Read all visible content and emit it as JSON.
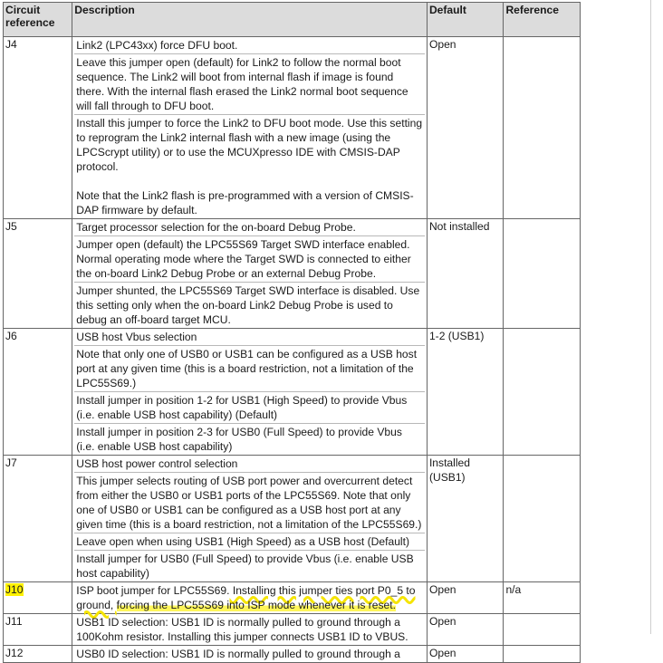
{
  "table": {
    "headers": {
      "circuit_reference": "Circuit reference",
      "description": "Description",
      "default": "Default",
      "reference": "Reference"
    },
    "rows": [
      {
        "ref": "J4",
        "desc": [
          "Link2 (LPC43xx) force DFU boot.",
          "Leave this jumper open (default) for Link2 to follow the normal boot sequence. The Link2 will boot from internal flash if image is found there. With the internal flash erased the Link2 normal boot sequence will fall through to DFU boot.",
          "Install this jumper to force the Link2 to DFU boot mode. Use this setting to reprogram the Link2 internal flash with a new image (using the LPCScrypt utility) or to use the MCUXpresso IDE with CMSIS-DAP protocol.",
          "Note that the Link2 flash is pre-programmed with a version of CMSIS-DAP firmware by default."
        ],
        "default": "Open",
        "reference": ""
      },
      {
        "ref": "J5",
        "desc": [
          "Target processor selection for the on-board Debug Probe.",
          "Jumper open (default) the LPC55S69 Target SWD interface enabled. Normal operating mode where the Target SWD is connected to either the on-board Link2 Debug Probe or an external Debug Probe.",
          "Jumper shunted, the LPC55S69 Target SWD interface is disabled. Use this setting only when the on-board Link2 Debug Probe is used to debug an off-board target MCU."
        ],
        "default": "Not installed",
        "reference": ""
      },
      {
        "ref": "J6",
        "desc": [
          "USB host Vbus selection",
          "Note that only one of USB0 or USB1 can be configured as a USB host port at any given time (this is a board restriction, not a limitation of the LPC55S69.)",
          "Install jumper in position 1-2 for USB1 (High Speed) to provide Vbus (i.e. enable USB host capability) (Default)",
          "Install jumper in position 2-3 for USB0 (Full Speed) to provide Vbus (i.e. enable USB host capability)"
        ],
        "default": "1-2 (USB1)",
        "reference": ""
      },
      {
        "ref": "J7",
        "desc": [
          "USB host power control selection",
          "This jumper selects routing of USB port power and overcurrent detect from either the USB0 or USB1 ports of the LPC55S69. Note that only one of USB0 or USB1 can be configured as a USB host port at any given time (this is a board restriction, not a limitation of the LPC55S69.)",
          "Leave open when using USB1 (High Speed) as a USB host (Default)",
          "Install jumper for USB0 (Full Speed) to provide Vbus (i.e. enable USB host capability)"
        ],
        "default": "Installed (USB1)",
        "reference": ""
      },
      {
        "ref": "J10",
        "desc_a": "ISP boot jumper for LPC55S69.",
        "desc_b": " Installing this jumper ties port P0_5 to ground, ",
        "desc_c": "forcing the LPC55S69 into ISP mode whenever it is reset.",
        "default": "Open",
        "reference": "n/a"
      },
      {
        "ref": "J11",
        "desc": [
          "USB1 ID selection: USB1 ID is normally pulled to ground through a 100Kohm resistor. Installing this jumper connects USB1 ID to VBUS."
        ],
        "default": "Open",
        "reference": ""
      },
      {
        "ref": "J12",
        "desc": [
          "USB0 ID selection: USB1 ID is normally pulled to ground through a"
        ],
        "default": "Open",
        "reference": ""
      }
    ]
  },
  "colors": {
    "header_bg": "#dcdcdc",
    "border": "#666666",
    "highlight": "#fff200"
  }
}
